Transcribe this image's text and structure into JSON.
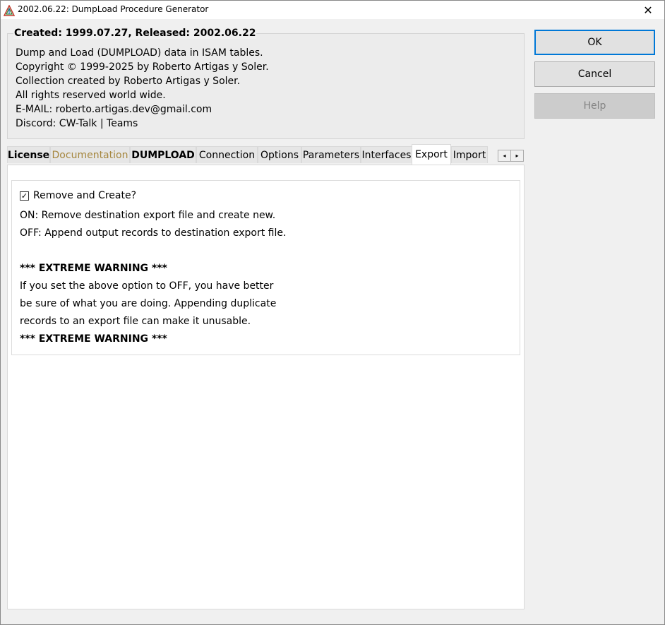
{
  "window": {
    "title": "2002.06.22: DumpLoad Procedure Generator",
    "close_glyph": "✕",
    "icon": "triangle-app-icon"
  },
  "info": {
    "caption": "Created: 1999.07.27, Released: 2002.06.22",
    "lines": [
      "Dump and Load (DUMPLOAD) data in ISAM tables.",
      "Copyright © 1999-2025 by Roberto Artigas y Soler.",
      "Collection created by Roberto Artigas y Soler.",
      "All rights reserved world wide.",
      "E-MAIL: roberto.artigas.dev@gmail.com",
      "Discord: CW-Talk | Teams"
    ]
  },
  "buttons": {
    "ok": "OK",
    "cancel": "Cancel",
    "help": "Help"
  },
  "tabs": [
    {
      "label": "License"
    },
    {
      "label": "Documentation"
    },
    {
      "label": "DUMPLOAD"
    },
    {
      "label": "Connection"
    },
    {
      "label": "Options"
    },
    {
      "label": "Parameters"
    },
    {
      "label": "Interfaces"
    },
    {
      "label": "Export"
    },
    {
      "label": "Import"
    }
  ],
  "active_tab": "Export",
  "tab_scroll": {
    "left": "◂",
    "right": "▸"
  },
  "export": {
    "checkbox_label": "Remove and Create?",
    "checkbox_checked": true,
    "check_glyph": "✓",
    "lines": [
      "ON: Remove destination export file and create new.",
      "OFF: Append output records to destination export file.",
      "",
      "*** EXTREME WARNING ***",
      "If you set the above option to OFF, you have better",
      "be sure of what you are doing. Appending duplicate",
      "records to an export file can make it unusable.",
      "*** EXTREME WARNING ***"
    ]
  },
  "colors": {
    "default_button_border": "#0078d7",
    "documentation_tab_text": "#a6873f",
    "disabled_text": "#838383"
  }
}
